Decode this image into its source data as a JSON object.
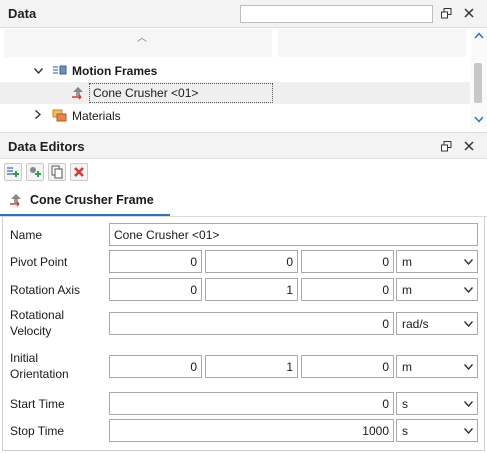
{
  "data_panel": {
    "title": "Data",
    "search_value": "",
    "tree": [
      {
        "label": "Motion Frames",
        "expanded": true,
        "icon": "motion-frames-icon"
      },
      {
        "label": "Cone Crusher <01>",
        "selected": true,
        "icon": "cone-crusher-frame-icon"
      },
      {
        "label": "Materials",
        "expanded": false,
        "icon": "materials-icon"
      }
    ]
  },
  "editors_panel": {
    "title": "Data Editors",
    "toolbar": [
      "add-frame-icon",
      "add-group-icon",
      "copy-icon",
      "delete-icon"
    ],
    "tab_label": "Cone Crusher Frame"
  },
  "form": {
    "name": {
      "label": "Name",
      "value": "Cone Crusher <01>"
    },
    "pivot_point": {
      "label": "Pivot Point",
      "x": "0",
      "y": "0",
      "z": "0",
      "unit": "m"
    },
    "rotation_axis": {
      "label": "Rotation Axis",
      "x": "0",
      "y": "1",
      "z": "0",
      "unit": "m"
    },
    "rotational_velocity": {
      "label_line1": "Rotational",
      "label_line2": "Velocity",
      "value": "0",
      "unit": "rad/s"
    },
    "initial_orientation": {
      "label_line1": "Initial",
      "label_line2": "Orientation",
      "x": "0",
      "y": "1",
      "z": "0",
      "unit": "m"
    },
    "start_time": {
      "label": "Start Time",
      "value": "0",
      "unit": "s"
    },
    "stop_time": {
      "label": "Stop Time",
      "value": "1000",
      "unit": "s"
    }
  },
  "colors": {
    "accent": "#2f6fc0",
    "delete": "#d93636",
    "add": "#2e9e4f"
  }
}
